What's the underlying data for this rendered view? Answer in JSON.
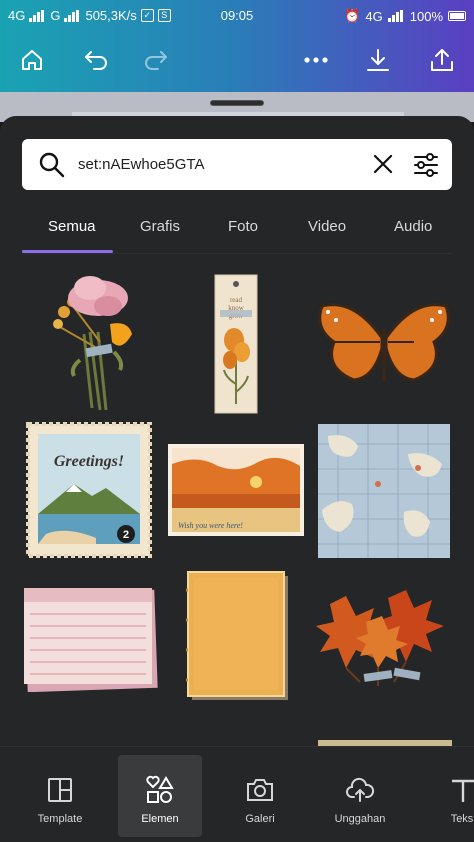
{
  "status_bar": {
    "network_left": "4G",
    "network_mid": "G",
    "speed": "505,3K/s",
    "time": "09:05",
    "network_right": "4G",
    "battery": "100%"
  },
  "toolbar": {
    "home_icon": "home-icon",
    "undo_icon": "undo-icon",
    "redo_icon": "redo-icon",
    "more_icon": "more-horizontal-icon",
    "download_icon": "download-icon",
    "share_icon": "share-icon"
  },
  "search": {
    "value": "set:nAEwhoe5GTA"
  },
  "tabs": [
    {
      "label": "Semua",
      "active": true
    },
    {
      "label": "Grafis",
      "active": false
    },
    {
      "label": "Foto",
      "active": false
    },
    {
      "label": "Video",
      "active": false
    },
    {
      "label": "Audio",
      "active": false
    }
  ],
  "elements": [
    {
      "name": "flower-bouquet"
    },
    {
      "name": "bookmark-read-know-grow",
      "text": "read · know · grow"
    },
    {
      "name": "butterfly"
    },
    {
      "name": "greetings-stamp",
      "text": "Greetings!",
      "number": "2"
    },
    {
      "name": "sunset-postcard",
      "text": "Wish you were here!"
    },
    {
      "name": "world-map"
    },
    {
      "name": "lined-note-cards"
    },
    {
      "name": "orange-notebook"
    },
    {
      "name": "autumn-leaves"
    }
  ],
  "bottom_nav": [
    {
      "label": "Template",
      "icon": "template-icon",
      "active": false
    },
    {
      "label": "Elemen",
      "icon": "elements-icon",
      "active": true
    },
    {
      "label": "Galeri",
      "icon": "camera-icon",
      "active": false
    },
    {
      "label": "Unggahan",
      "icon": "upload-cloud-icon",
      "active": false
    },
    {
      "label": "Teks",
      "icon": "text-icon",
      "active": false
    }
  ],
  "colors": {
    "header_gradient_start": "#1aa3b3",
    "header_gradient_end": "#5b3fc2",
    "sheet_bg": "#252627",
    "tab_accent": "#8b6ee8"
  }
}
